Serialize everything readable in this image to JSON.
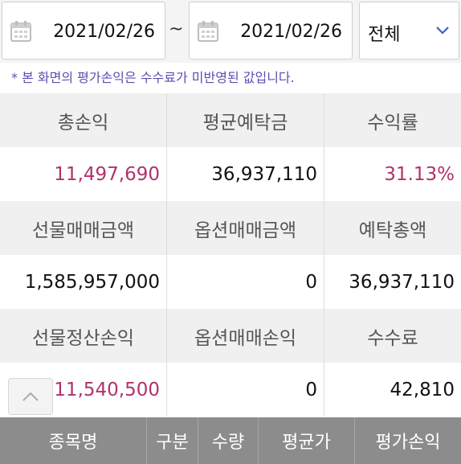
{
  "filter": {
    "start_date": "2021/02/26",
    "separator": "~",
    "end_date": "2021/02/26",
    "category_selected": "전체"
  },
  "notice": "* 본 화면의 평가손익은 수수료가 미반영된 값입니다.",
  "summary": {
    "row1": {
      "headers": [
        "총손익",
        "평균예탁금",
        "수익률"
      ],
      "values": [
        "11,497,690",
        "36,937,110",
        "31.13%"
      ]
    },
    "row2": {
      "headers": [
        "선물매매금액",
        "옵션매매금액",
        "예탁총액"
      ],
      "values": [
        "1,585,957,000",
        "0",
        "36,937,110"
      ]
    },
    "row3": {
      "headers": [
        "선물정산손익",
        "옵션매매손익",
        "수수료"
      ],
      "values": [
        "11,540,500",
        "0",
        "42,810"
      ]
    }
  },
  "table_header": [
    "종목명",
    "구분",
    "수량",
    "평균가",
    "평가손익"
  ],
  "colors": {
    "profit": "#b0326a",
    "notice": "#5a4fb0",
    "footer_bg": "#8c8c8c"
  },
  "icons": {
    "date": "calendar-icon",
    "select": "chevron-down-icon",
    "scroll_top": "chevron-up-icon"
  }
}
